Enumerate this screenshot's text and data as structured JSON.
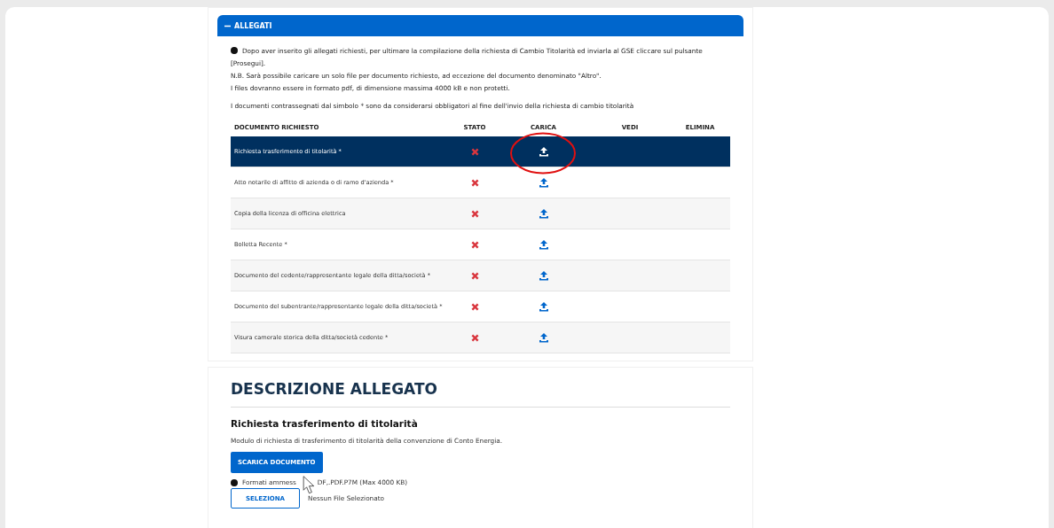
{
  "panel": {
    "title": "ALLEGATI",
    "expanded": true,
    "info": [
      "Dopo aver inserito gli allegati richiesti, per ultimare la compilazione della richiesta di Cambio Titolarità ed inviarla al GSE cliccare sul pulsante [Prosegui].",
      "N.B. Sarà possibile caricare un solo file per documento richiesto, ad eccezione del documento denominato \"Altro\".",
      "I files dovranno essere in formato pdf, di dimensione massima 4000 kB e non protetti."
    ],
    "note": "I documenti contrassegnati dal simbolo * sono da considerarsi obbligatori al fine dell'invio della richiesta di cambio titolarità"
  },
  "table": {
    "columns": [
      "DOCUMENTO RICHIESTO",
      "STATO",
      "CARICA",
      "VEDI",
      "ELIMINA"
    ],
    "rows": [
      {
        "document": "Richiesta trasferimento di titolarità *",
        "uploaded": false,
        "selected": true
      },
      {
        "document": "Atto notarile di affitto di azienda o di ramo d'azienda *",
        "uploaded": false,
        "selected": false
      },
      {
        "document": "Copia della licenza di officina elettrica",
        "uploaded": false,
        "selected": false
      },
      {
        "document": "Bolletta Recente *",
        "uploaded": false,
        "selected": false
      },
      {
        "document": "Documento del cedente/rappresentante legale della ditta/società *",
        "uploaded": false,
        "selected": false
      },
      {
        "document": "Documento del subentrante/rappresentante legale della ditta/società *",
        "uploaded": false,
        "selected": false
      },
      {
        "document": "Visura camerale storica della ditta/società cedente *",
        "uploaded": false,
        "selected": false
      }
    ]
  },
  "description": {
    "title": "DESCRIZIONE ALLEGATO",
    "subtitle": "Richiesta trasferimento di titolarità",
    "text": "Modulo di richiesta di trasferimento di titolarità della convenzione di Conto Energia.",
    "download_button": "SCARICA DOCUMENTO",
    "formats_before_cursor": "Formati ammess",
    "formats_after_cursor": "DF,.PDF.P7M (Max 4000 KB)",
    "select_button": "SELEZIONA",
    "file_status": "Nessun File Selezionato"
  }
}
